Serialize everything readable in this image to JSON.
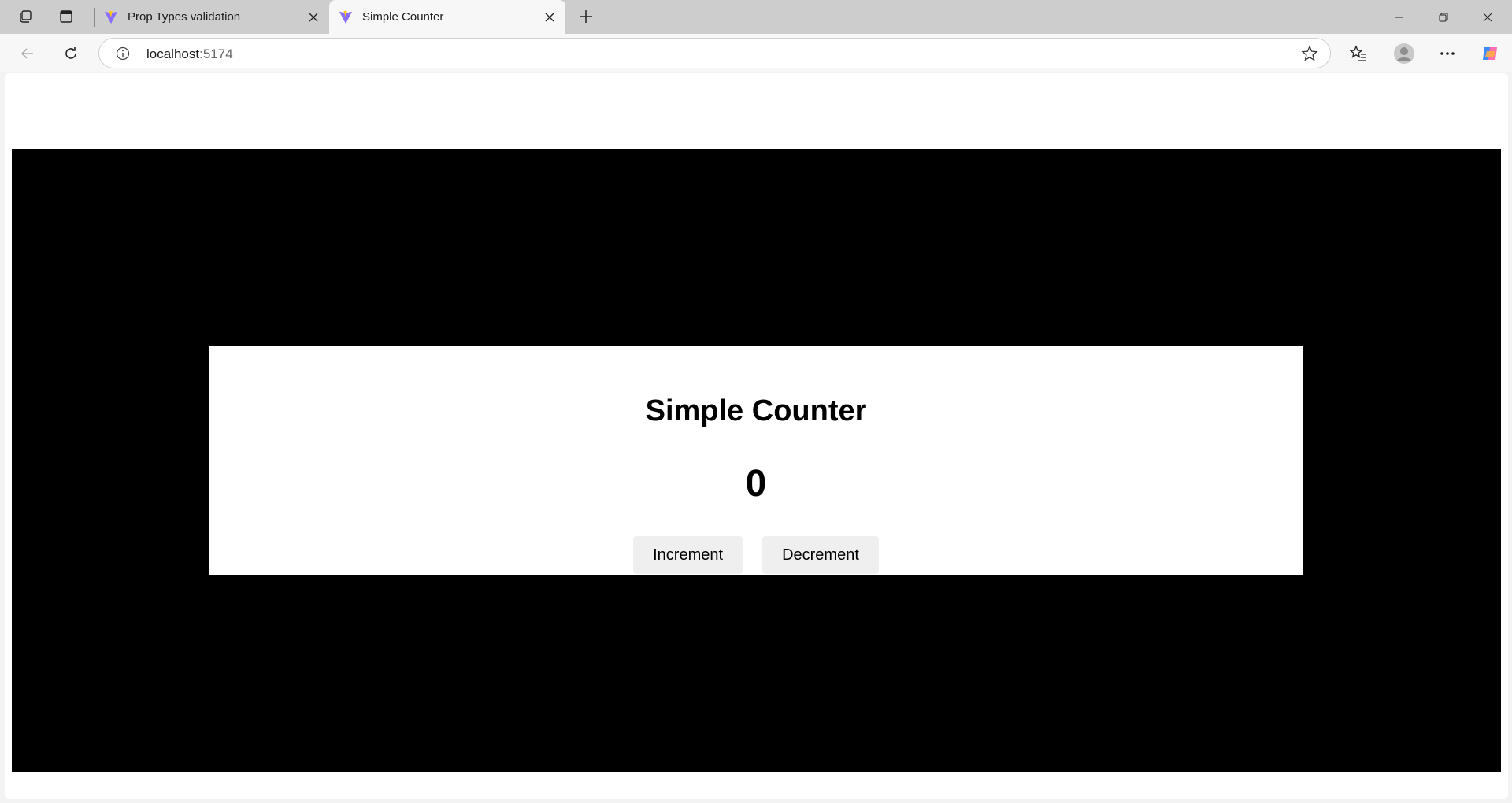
{
  "browser": {
    "tabs": [
      {
        "title": "Prop Types validation",
        "active": false
      },
      {
        "title": "Simple Counter",
        "active": true
      }
    ],
    "address": {
      "host": "localhost",
      "port": ":5174"
    }
  },
  "app": {
    "title": "Simple Counter",
    "count": "0",
    "increment_label": "Increment",
    "decrement_label": "Decrement"
  },
  "colors": {
    "stage_bg": "#000000",
    "card_bg": "#ffffff",
    "button_bg": "#efefef"
  }
}
